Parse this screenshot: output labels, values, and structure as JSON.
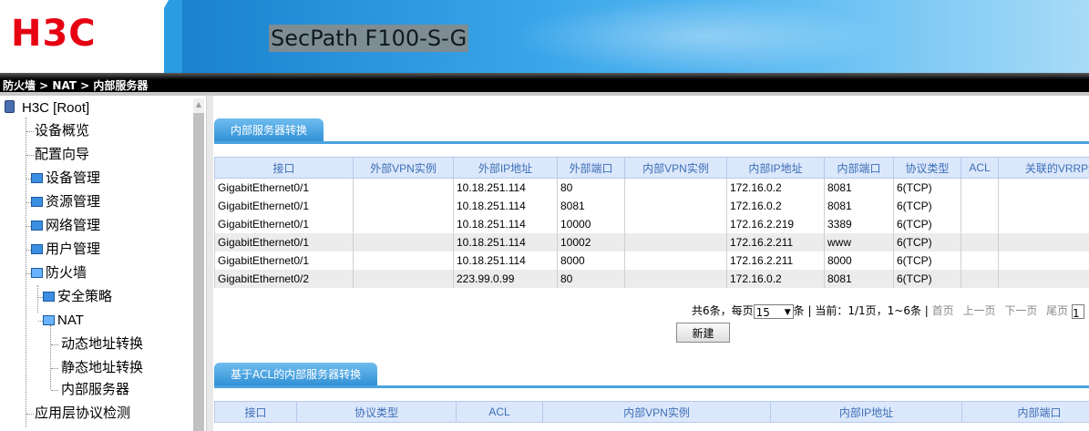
{
  "header": {
    "logo_text": "H3C",
    "product_name": "SecPath F100-S-G"
  },
  "breadcrumb": "防火墙 > NAT > 内部服务器",
  "sidebar": {
    "root": "H3C [Root]",
    "items": [
      "设备概览",
      "配置向导",
      "设备管理",
      "资源管理",
      "网络管理",
      "用户管理",
      "防火墙",
      "安全策略",
      "NAT",
      "动态地址转换",
      "静态地址转换",
      "内部服务器",
      "应用层协议检测"
    ]
  },
  "section1": {
    "tab_label": "内部服务器转换",
    "columns": [
      "接口",
      "外部VPN实例",
      "外部IP地址",
      "外部端口",
      "内部VPN实例",
      "内部IP地址",
      "内部端口",
      "协议类型",
      "ACL",
      "关联的VRRP组"
    ],
    "rows": [
      [
        "GigabitEthernet0/1",
        "",
        "10.18.251.114",
        "80",
        "",
        "172.16.0.2",
        "8081",
        "6(TCP)",
        "",
        ""
      ],
      [
        "GigabitEthernet0/1",
        "",
        "10.18.251.114",
        "8081",
        "",
        "172.16.0.2",
        "8081",
        "6(TCP)",
        "",
        ""
      ],
      [
        "GigabitEthernet0/1",
        "",
        "10.18.251.114",
        "10000",
        "",
        "172.16.2.219",
        "3389",
        "6(TCP)",
        "",
        ""
      ],
      [
        "GigabitEthernet0/1",
        "",
        "10.18.251.114",
        "10002",
        "",
        "172.16.2.211",
        "www",
        "6(TCP)",
        "",
        ""
      ],
      [
        "GigabitEthernet0/1",
        "",
        "10.18.251.114",
        "8000",
        "",
        "172.16.2.211",
        "8000",
        "6(TCP)",
        "",
        ""
      ],
      [
        "GigabitEthernet0/2",
        "",
        "223.99.0.99",
        "80",
        "",
        "172.16.0.2",
        "8081",
        "6(TCP)",
        "",
        ""
      ]
    ]
  },
  "pager": {
    "total_prefix": "共6条，每页",
    "page_size": "15",
    "status": "条 | 当前：1/1页，1~6条 |",
    "first": "首页",
    "prev": "上一页",
    "next": "下一页",
    "last": "尾页",
    "page_input": "1"
  },
  "new_button": "新建",
  "section2": {
    "tab_label": "基于ACL的内部服务器转换",
    "columns": [
      "接口",
      "协议类型",
      "ACL",
      "内部VPN实例",
      "内部IP地址",
      "内部端口"
    ]
  },
  "colors": {
    "header_blue": "#2a9ce2",
    "logo_red": "#e60012",
    "tab_blue": "#2f8fd4",
    "table_header_bg": "#dbe7fb",
    "table_header_text": "#3d6fb6"
  }
}
